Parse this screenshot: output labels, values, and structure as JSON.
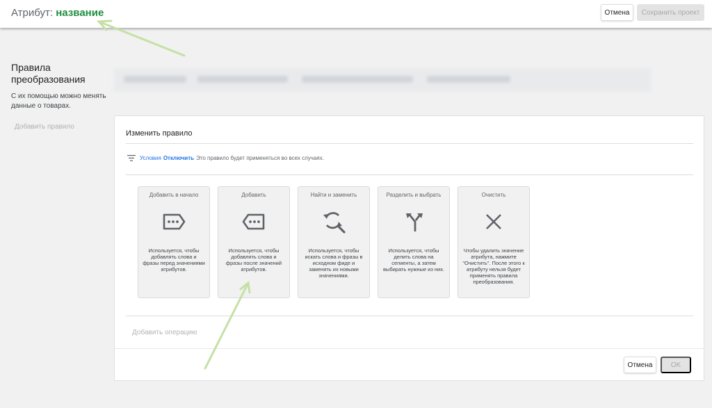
{
  "header": {
    "attribute_label": "Атрибут:",
    "attribute_value": "название",
    "cancel_label": "Отмена",
    "save_label": "Сохранить проект"
  },
  "sidebar": {
    "title": "Правила преобразования",
    "description": "С их помощью можно менять данные о товарах.",
    "add_rule_label": "Добавить правило"
  },
  "panel": {
    "title": "Изменить правило",
    "conditions": {
      "label": "Условия",
      "disable_link": "Отключить",
      "text": "Это правило будет применяться во всех случаях."
    },
    "operations": [
      {
        "title": "Добавить в начало",
        "icon": "tag-prepend-icon",
        "description": "Используется, чтобы добавлять слова и фразы перед значениями атрибутов."
      },
      {
        "title": "Добавить",
        "icon": "tag-append-icon",
        "description": "Используется, чтобы добавлять слова и фразы после значений атрибутов."
      },
      {
        "title": "Найти и заменить",
        "icon": "find-replace-icon",
        "description": "Используется, чтобы искать слова и фразы в исходном фиде и заменять их новыми значениями."
      },
      {
        "title": "Разделить и выбрать",
        "icon": "split-arrow-icon",
        "description": "Используется, чтобы делить слова на сегменты, а затем выбирать нужные из них."
      },
      {
        "title": "Очистить",
        "icon": "close-icon",
        "description": "Чтобы удалить значение атрибута, нажмите \"Очистить\". После этого к атрибуту нельзя будет применять правила преобразования."
      }
    ],
    "add_operation_label": "Добавить операцию",
    "cancel_label": "Отмена",
    "ok_label": "OK"
  },
  "colors": {
    "attribute_value": "#1e8e3e",
    "link": "#1a73e8",
    "annotation_arrow": "#c5e0a5",
    "icon": "#5f6368"
  }
}
